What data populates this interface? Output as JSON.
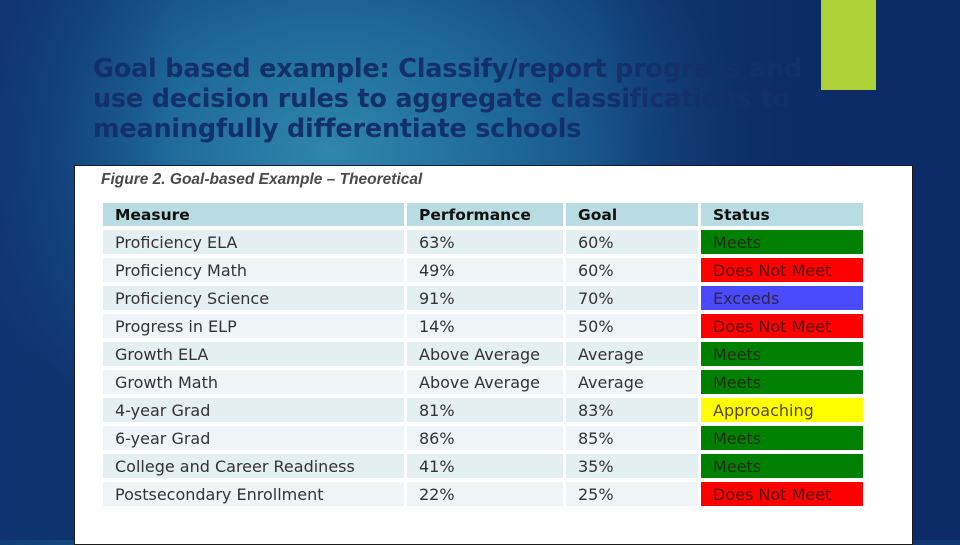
{
  "slide": {
    "title": "Goal based example: Classify/report progress and use decision rules to aggregate classifications to meaningfully differentiate schools",
    "accent_color": "#add136"
  },
  "figure": {
    "caption": "Figure 2. Goal-based Example – Theoretical",
    "columns": [
      "Measure",
      "Performance",
      "Goal",
      "Status"
    ],
    "status_colors": {
      "Meets": "#008000",
      "Does Not Meet": "#ff0000",
      "Exceeds": "#4a4aff",
      "Approaching": "#ffff00"
    },
    "rows": [
      {
        "measure": "Proficiency ELA",
        "performance": "63%",
        "goal": "60%",
        "status": "Meets"
      },
      {
        "measure": "Proficiency Math",
        "performance": "49%",
        "goal": "60%",
        "status": "Does Not Meet"
      },
      {
        "measure": "Proficiency Science",
        "performance": "91%",
        "goal": "70%",
        "status": "Exceeds"
      },
      {
        "measure": "Progress in ELP",
        "performance": "14%",
        "goal": "50%",
        "status": "Does Not Meet"
      },
      {
        "measure": "Growth ELA",
        "performance": "Above Average",
        "goal": "Average",
        "status": "Meets"
      },
      {
        "measure": "Growth Math",
        "performance": "Above Average",
        "goal": "Average",
        "status": "Meets"
      },
      {
        "measure": "4-year Grad",
        "performance": "81%",
        "goal": "83%",
        "status": "Approaching"
      },
      {
        "measure": "6-year Grad",
        "performance": "86%",
        "goal": "85%",
        "status": "Meets"
      },
      {
        "measure": "College and Career Readiness",
        "performance": "41%",
        "goal": "35%",
        "status": "Meets"
      },
      {
        "measure": "Postsecondary Enrollment",
        "performance": "22%",
        "goal": "25%",
        "status": "Does Not Meet"
      }
    ]
  }
}
